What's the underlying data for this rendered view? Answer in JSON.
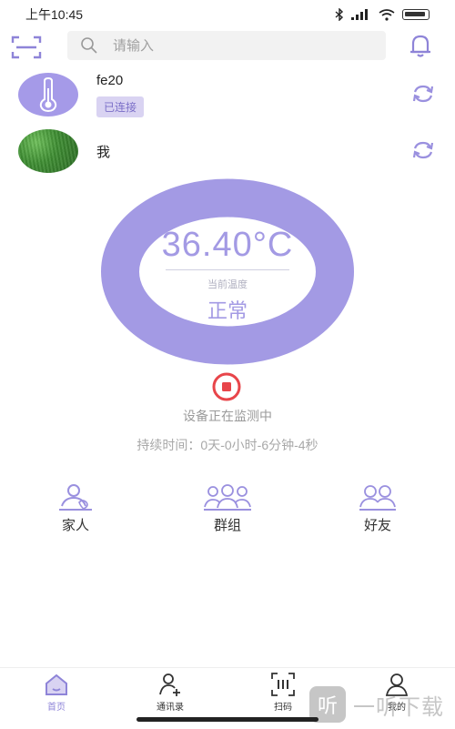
{
  "status_bar": {
    "time": "上午10:45",
    "battery_label": "100"
  },
  "search": {
    "placeholder": "请输入"
  },
  "contacts": [
    {
      "name": "fe20",
      "status": "已连接"
    },
    {
      "name": "我"
    }
  ],
  "reading": {
    "value": "36.40",
    "unit": "°C",
    "label": "当前温度",
    "status": "正常"
  },
  "monitor": {
    "text": "设备正在监测中",
    "duration": "持续时间：0天-0小时-6分钟-4秒"
  },
  "quick_actions": [
    {
      "label": "家人",
      "icon": "family-icon"
    },
    {
      "label": "群组",
      "icon": "group-icon"
    },
    {
      "label": "好友",
      "icon": "friends-icon"
    }
  ],
  "nav": [
    {
      "label": "首页",
      "icon": "home-icon"
    },
    {
      "label": "通讯录",
      "icon": "contacts-icon"
    },
    {
      "label": "扫码",
      "icon": "scan-icon"
    },
    {
      "label": "我的",
      "icon": "user-icon"
    }
  ],
  "watermark": {
    "logo": "听",
    "text": "一听下载"
  },
  "colors": {
    "accent": "#a39ae4",
    "stop": "#e8454a"
  }
}
